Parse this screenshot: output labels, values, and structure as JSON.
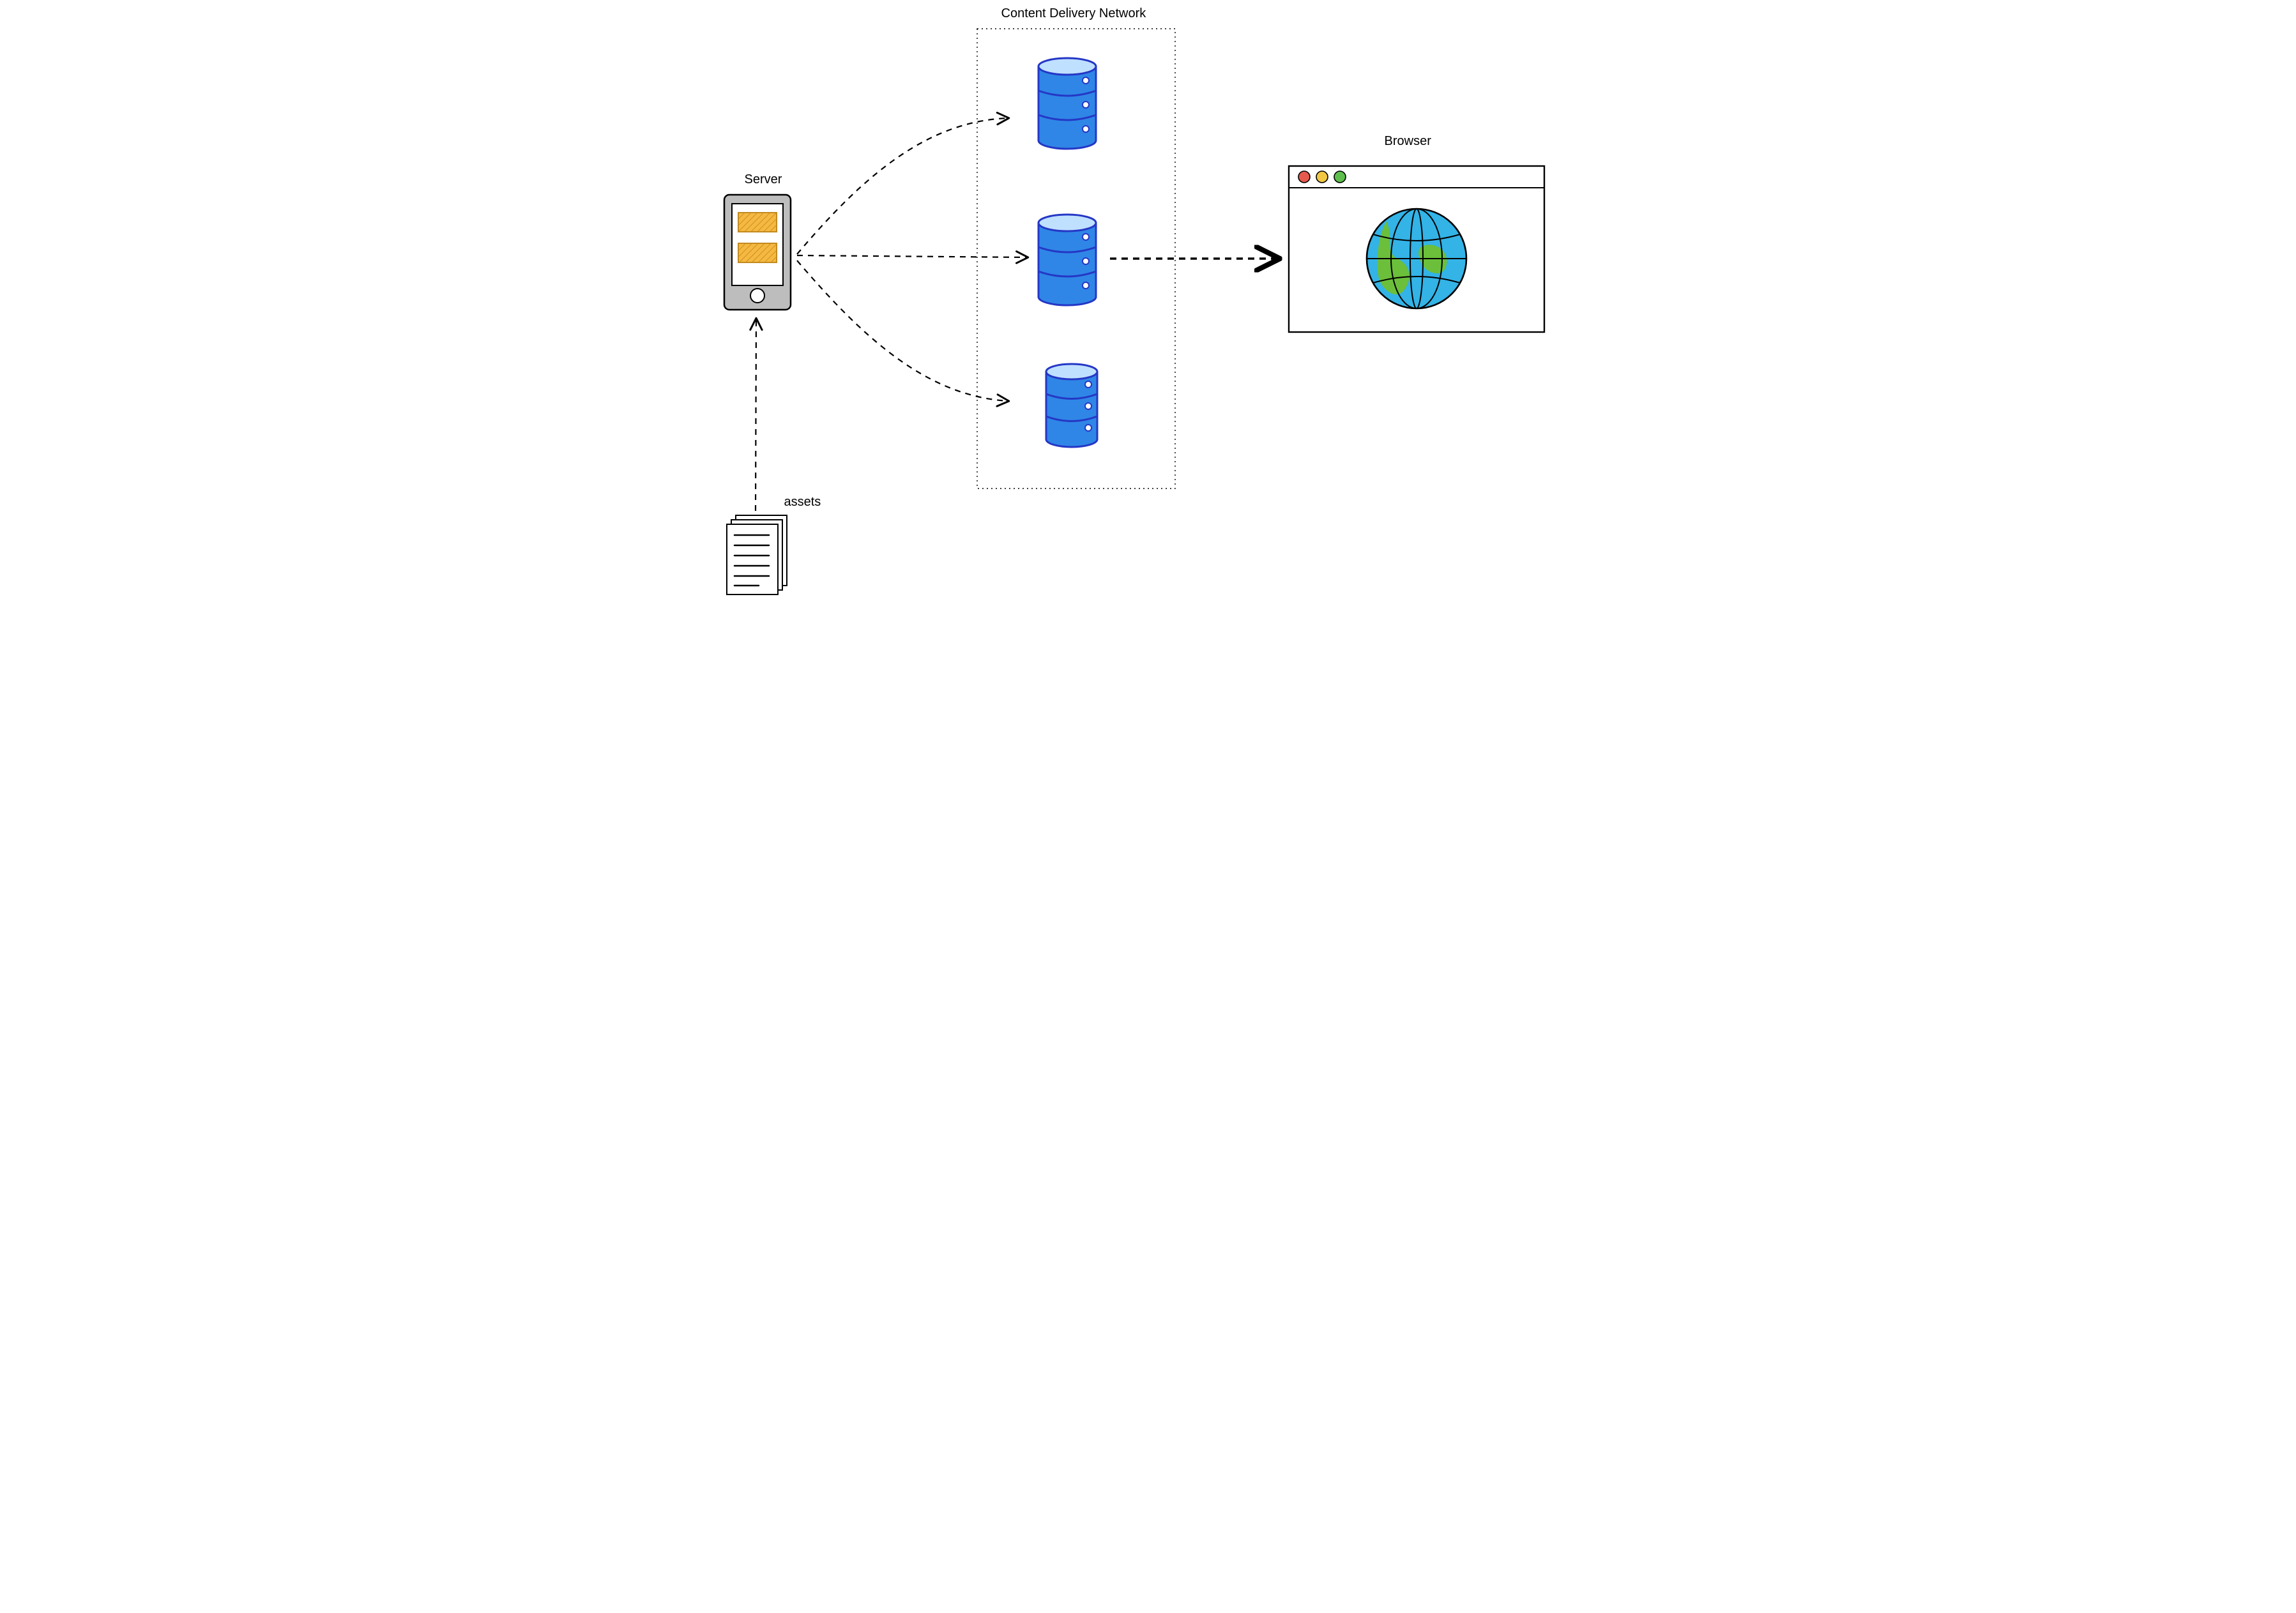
{
  "labels": {
    "server": "Server",
    "cdn": "Content Delivery Network",
    "browser": "Browser",
    "assets": "assets"
  },
  "nodes": {
    "server": {
      "type": "server",
      "role": "origin server / device with cards"
    },
    "assets": {
      "type": "documents",
      "role": "static asset files feeding the server"
    },
    "cdn": {
      "type": "group",
      "role": "CDN region containing edge caches",
      "children": [
        "cache-top",
        "cache-middle",
        "cache-bottom"
      ]
    },
    "cache-top": {
      "type": "database-cylinder",
      "role": "CDN cache node"
    },
    "cache-middle": {
      "type": "database-cylinder",
      "role": "CDN cache node"
    },
    "cache-bottom": {
      "type": "database-cylinder",
      "role": "CDN cache node"
    },
    "browser": {
      "type": "browser-window-globe",
      "role": "end-user browser"
    }
  },
  "edges": [
    {
      "from": "assets",
      "to": "server",
      "style": "dashed-arrow"
    },
    {
      "from": "server",
      "to": "cache-top",
      "style": "dashed-arrow-curved"
    },
    {
      "from": "server",
      "to": "cache-middle",
      "style": "dashed-arrow"
    },
    {
      "from": "server",
      "to": "cache-bottom",
      "style": "dashed-arrow-curved"
    },
    {
      "from": "cdn",
      "to": "browser",
      "style": "dashed-arrow-bold"
    }
  ],
  "colors": {
    "cylinder": "#2f86e6",
    "cylinderStroke": "#2537c6",
    "serverBody": "#bdbdbd",
    "serverCard": "#f5b942",
    "globe": "#33b3e6",
    "land": "#6bbf3a",
    "red": "#e65a4d",
    "yellow": "#f2c744",
    "green": "#5fbf4d"
  }
}
